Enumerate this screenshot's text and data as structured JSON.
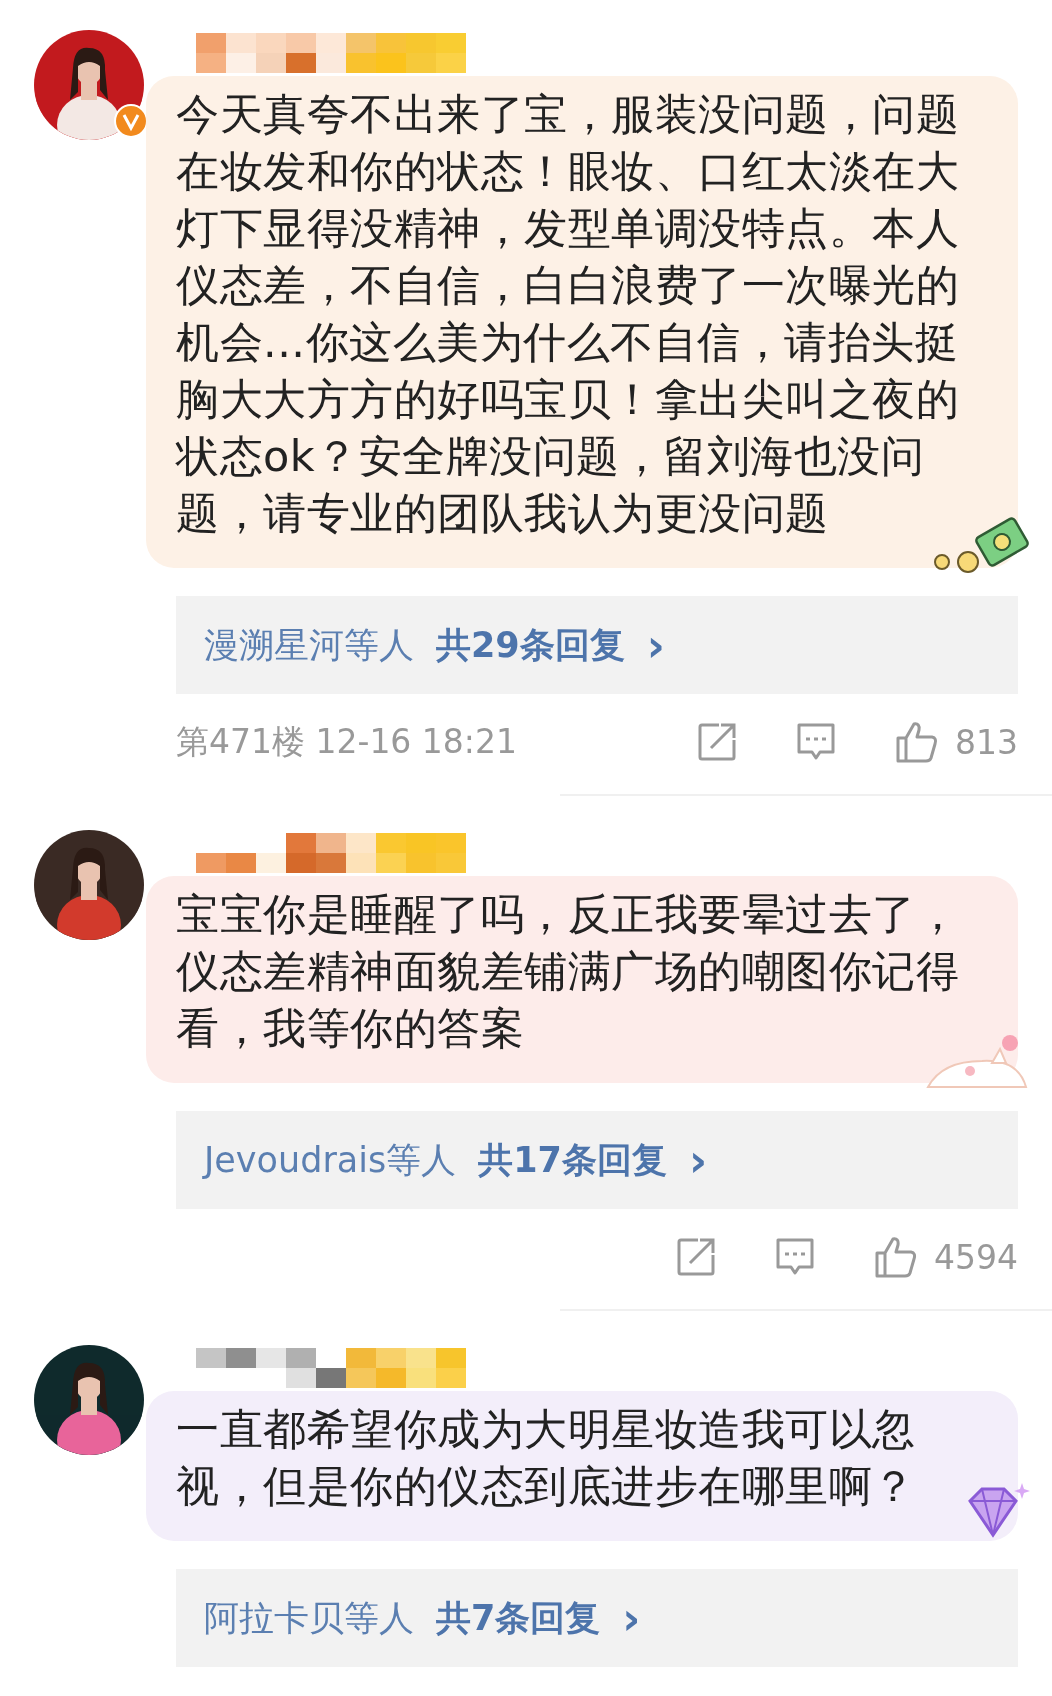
{
  "comments": [
    {
      "verified": true,
      "text": "今天真夸不出来了宝，服装没问题，问题在妆发和你的状态！眼妆、口红太淡在大灯下显得没精神，发型单调没特点。本人仪态差，不自信，白白浪费了一次曝光的机会...你这么美为什么不自信，请抬头挺胸大大方方的好吗宝贝！拿出尖叫之夜的状态ok？安全牌没问题，留刘海也没问题，请专业的团队我认为更没问题",
      "color": "#fdf1e6",
      "sticker": {
        "kind": "money"
      },
      "replies": {
        "names": "漫溯星河等人",
        "count": "共29条回复",
        "chevron": "›"
      },
      "footer": {
        "floor_time": "第471楼 12-16 18:21",
        "likes": "813"
      }
    },
    {
      "verified": false,
      "text": "宝宝你是睡醒了吗，反正我要晕过去了，仪态差精神面貌差铺满广场的嘲图你记得看，我等你的答案",
      "color": "#fdecea",
      "sticker": {
        "kind": "cat"
      },
      "replies": {
        "names": "Jevoudrais等人",
        "count": "共17条回复",
        "chevron": "›"
      },
      "footer": {
        "likes": "4594"
      }
    },
    {
      "verified": false,
      "text": "一直都希望你成为大明星妆造我可以忽视，但是你的仪态到底进步在哪里啊？",
      "color": "#f3eefa",
      "sticker": {
        "kind": "gem"
      },
      "replies": {
        "names": "阿拉卡贝等人",
        "count": "共7条回复",
        "chevron": "›"
      }
    }
  ]
}
